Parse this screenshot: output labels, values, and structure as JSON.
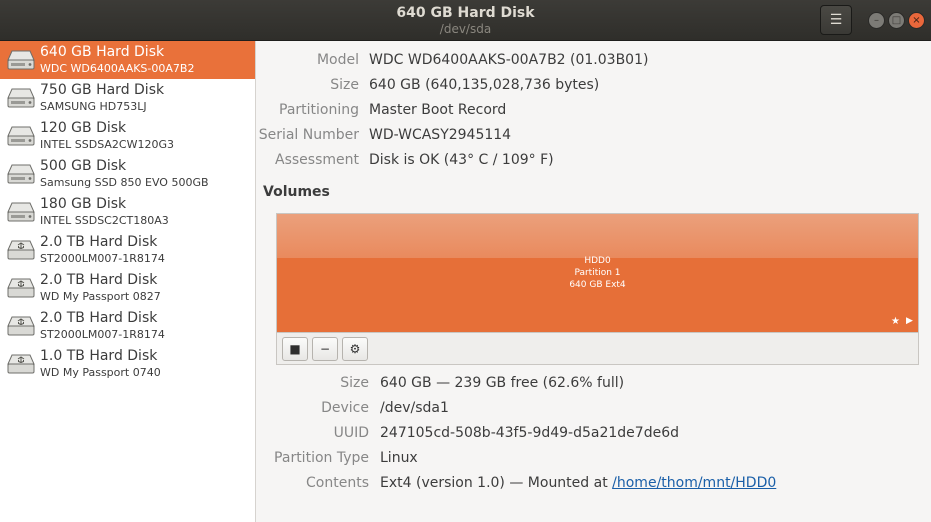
{
  "window": {
    "title": "640 GB Hard Disk",
    "subtitle": "/dev/sda",
    "menu_glyph": "☰",
    "minimize_glyph": "–",
    "maximize_glyph": "□",
    "close_glyph": "×"
  },
  "sidebar": {
    "items": [
      {
        "name": "640 GB Hard Disk",
        "sub": "WDC WD6400AAKS-00A7B2",
        "icon": "hard-disk-icon",
        "selected": true
      },
      {
        "name": "750 GB Hard Disk",
        "sub": "SAMSUNG HD753LJ",
        "icon": "hard-disk-icon"
      },
      {
        "name": "120 GB Disk",
        "sub": "INTEL SSDSA2CW120G3",
        "icon": "hard-disk-icon"
      },
      {
        "name": "500 GB Disk",
        "sub": "Samsung SSD 850 EVO 500GB",
        "icon": "hard-disk-icon"
      },
      {
        "name": "180 GB Disk",
        "sub": "INTEL SSDSC2CT180A3",
        "icon": "hard-disk-icon"
      },
      {
        "name": "2.0 TB Hard Disk",
        "sub": "ST2000LM007-1R8174",
        "icon": "usb-disk-icon"
      },
      {
        "name": "2.0 TB Hard Disk",
        "sub": "WD My Passport 0827",
        "icon": "usb-disk-icon"
      },
      {
        "name": "2.0 TB Hard Disk",
        "sub": "ST2000LM007-1R8174",
        "icon": "usb-disk-icon"
      },
      {
        "name": "1.0 TB Hard Disk",
        "sub": "WD My Passport 0740",
        "icon": "usb-disk-icon"
      }
    ]
  },
  "disk": {
    "model_label": "Model",
    "model": "WDC WD6400AAKS-00A7B2 (01.03B01)",
    "size_label": "Size",
    "size": "640 GB (640,135,028,736 bytes)",
    "partitioning_label": "Partitioning",
    "partitioning": "Master Boot Record",
    "serial_label": "Serial Number",
    "serial": "WD-WCASY2945114",
    "assessment_label": "Assessment",
    "assessment": "Disk is OK (43° C / 109° F)"
  },
  "volumes": {
    "title": "Volumes",
    "block": {
      "line1": "HDD0",
      "line2": "Partition 1",
      "line3": "640 GB Ext4",
      "star": "★",
      "arrow": "▶"
    },
    "toolbar": {
      "stop": "■",
      "remove": "−",
      "gear": "⚙"
    },
    "size_label": "Size",
    "size": "640 GB — 239 GB free (62.6% full)",
    "device_label": "Device",
    "device": "/dev/sda1",
    "uuid_label": "UUID",
    "uuid": "247105cd-508b-43f5-9d49-d5a21de7de6d",
    "ptype_label": "Partition Type",
    "ptype": "Linux",
    "contents_label": "Contents",
    "contents_prefix": "Ext4 (version 1.0) — Mounted at ",
    "mount_link": "/home/thom/mnt/HDD0"
  },
  "colors": {
    "accent": "#e9713a",
    "titlebar": "#3c3b37",
    "link": "#1a5fa8"
  }
}
